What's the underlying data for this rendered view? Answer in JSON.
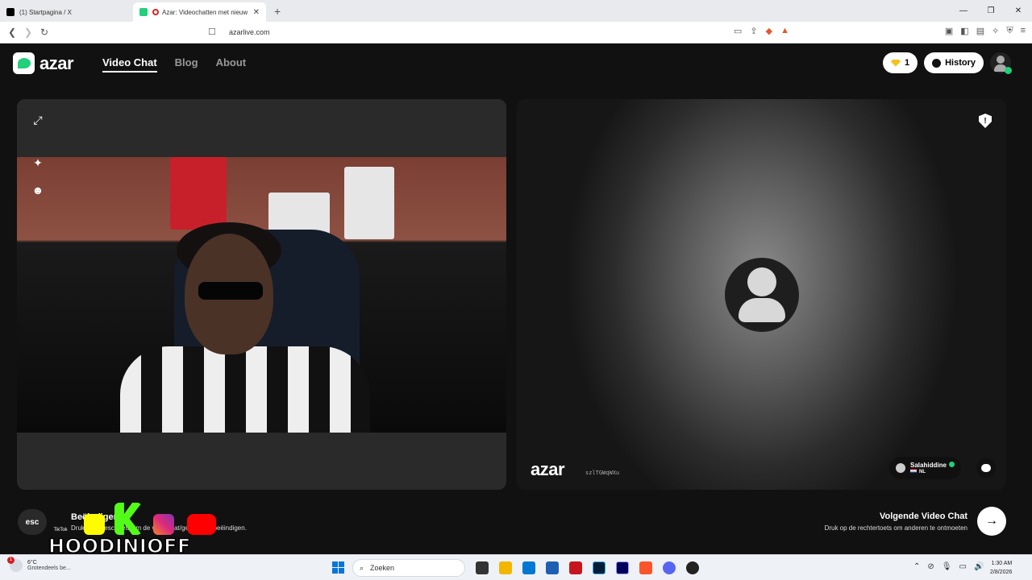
{
  "browser": {
    "tabs": [
      {
        "title": "(1) Startpagina / X"
      },
      {
        "title": "Azar: Videochatten met nieuw"
      }
    ],
    "url": "azarlive.com"
  },
  "site": {
    "logo": "azar",
    "nav": [
      {
        "label": "Video Chat",
        "active": true
      },
      {
        "label": "Blog"
      },
      {
        "label": "About"
      }
    ],
    "gems": "1",
    "history_label": "History"
  },
  "remote": {
    "watermark": "azar",
    "code": "szlTGWqWXu",
    "username": "Salahiddine",
    "country": "NL"
  },
  "bottom": {
    "esc_label": "esc",
    "stop_title": "Beëindigen",
    "stop_hint": "Druk op de esc-toets om de videochat/gesprek te beëindigen.",
    "next_title": "Volgende Video Chat",
    "next_hint": "Druk op de rechtertoets om anderen te ontmoeten"
  },
  "overlay": {
    "channel": "HOODINIOFF",
    "tiktok_label": "TikTok"
  },
  "taskbar": {
    "temp": "6°C",
    "weather": "Grotendeels be...",
    "weather_badge": "1",
    "search": "Zoeken",
    "time": "1:30 AM",
    "date": "2/8/2026"
  },
  "colors": {
    "brand": "#21d07a",
    "gem": "#f6c21a"
  }
}
